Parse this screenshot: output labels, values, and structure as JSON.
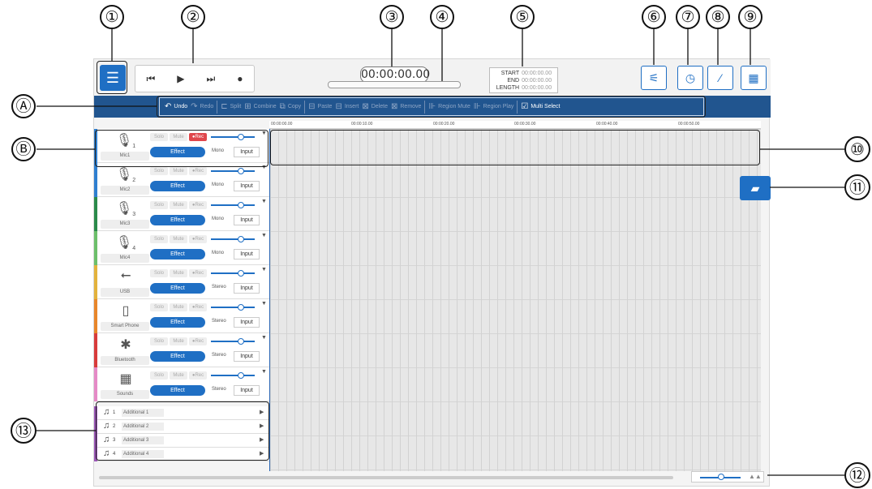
{
  "callouts": [
    "①",
    "②",
    "③",
    "④",
    "⑤",
    "⑥",
    "⑦",
    "⑧",
    "⑨",
    "Ⓐ",
    "Ⓑ",
    "⑩",
    "⑪",
    "⑫",
    "⑬"
  ],
  "transport": {
    "prev": "⏮",
    "play": "▶",
    "next": "⏭",
    "record": "●"
  },
  "timecode": "00:00:00.00",
  "selection": {
    "start_label": "START",
    "start_value": "00:00:00.00",
    "end_label": "END",
    "end_value": "00:00:00.00",
    "length_label": "LENGTH",
    "length_value": "00:00:00.00"
  },
  "edit_toolbar": {
    "undo": "Undo",
    "redo": "Redo",
    "split": "Split",
    "combine": "Combine",
    "copy": "Copy",
    "paste": "Paste",
    "insert": "Insert",
    "delete": "Delete",
    "remove": "Remove",
    "region_mute": "Region Mute",
    "region_play": "Region Play",
    "multi_select": "Multi Select"
  },
  "ruler": [
    "00:00:00.00",
    "00:00:10.00",
    "00:00:20.00",
    "00:00:30.00",
    "00:00:40.00",
    "00:00:50.00"
  ],
  "track_buttons": {
    "solo": "Solo",
    "mute": "Mute",
    "rec": "●Rec",
    "effect": "Effect",
    "input": "Input"
  },
  "tracks": [
    {
      "icon": "🎙",
      "num": "1",
      "name": "Mic1",
      "mode": "Mono",
      "color": "#2f7fd0",
      "rec_active": true
    },
    {
      "icon": "🎙",
      "num": "2",
      "name": "Mic2",
      "mode": "Mono",
      "color": "#2f7fd0",
      "rec_active": false
    },
    {
      "icon": "🎙",
      "num": "3",
      "name": "Mic3",
      "mode": "Mono",
      "color": "#2a8a4a",
      "rec_active": false
    },
    {
      "icon": "🎙",
      "num": "4",
      "name": "Mic4",
      "mode": "Mono",
      "color": "#6cbf6a",
      "rec_active": false
    },
    {
      "icon": "⭠",
      "num": "",
      "name": "USB",
      "mode": "Stereo",
      "color": "#e3b23c",
      "rec_active": false
    },
    {
      "icon": "▯",
      "num": "",
      "name": "Smart Phone",
      "mode": "Stereo",
      "color": "#e8862a",
      "rec_active": false
    },
    {
      "icon": "✱",
      "num": "",
      "name": "Bluetooth",
      "mode": "Stereo",
      "color": "#d83b3b",
      "rec_active": false
    },
    {
      "icon": "▦",
      "num": "",
      "name": "Sounds",
      "mode": "Stereo",
      "color": "#e58ac6",
      "rec_active": false
    }
  ],
  "additional": [
    {
      "num": "1",
      "name": "Additional 1"
    },
    {
      "num": "2",
      "name": "Additional 2"
    },
    {
      "num": "3",
      "name": "Additional 3"
    },
    {
      "num": "4",
      "name": "Additional 4"
    }
  ],
  "colors": {
    "accent": "#1f6fc4",
    "edit_bar": "#21558f",
    "rec": "#e0474c",
    "additional": "#9c56b8"
  }
}
